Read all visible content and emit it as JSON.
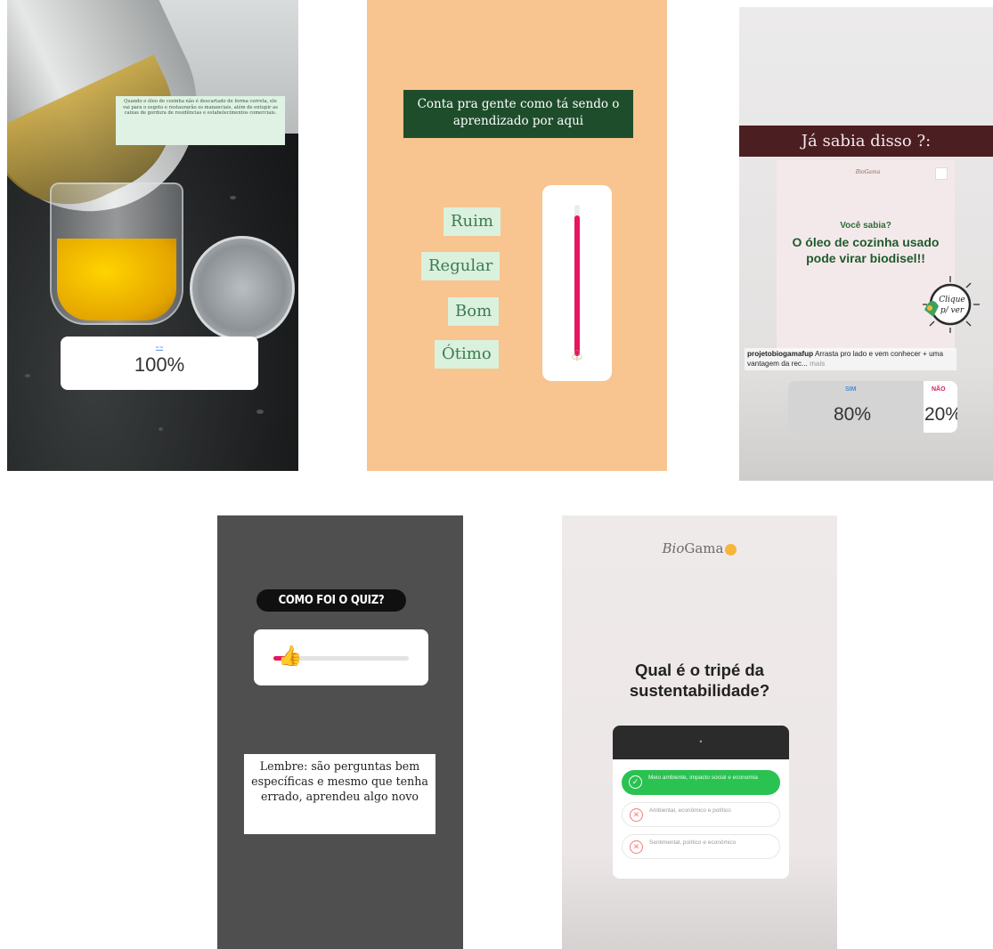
{
  "story_1": {
    "caption": "Quando o óleo de cozinha não é descartado de forma correta, ele vai para o esgoto e restaurarão os mananciais, além de entupir as caixas de gordura de residências e estabelecimentos comerciais.",
    "poll_icon": "slider-icon",
    "poll_value": "100%"
  },
  "story_2": {
    "title": "Conta pra gente como tá sendo o aprendizado por aqui",
    "options": [
      "Ruim",
      "Regular",
      "Bom",
      "Ótimo"
    ],
    "slider_level": 0.93,
    "slider_color": "#e8145f"
  },
  "story_3": {
    "header": "Já sabia disso ?:",
    "card_logo": "BioGama",
    "card_kicker": "Você sabia?",
    "card_headline": "O óleo de cozinha usado pode virar biodisel!!",
    "badge_text": "Clique p/ ver",
    "caption_user": "projetobiogamafup",
    "caption_text": " Arrasta pro lado e vem conhecer + uma vantagem da rec...",
    "caption_more": " mais",
    "poll": {
      "yes_label": "SIM",
      "yes_value": "80%",
      "no_label": "NÃO",
      "no_value": "20%",
      "yes_color": "#4a90d9",
      "no_color": "#d81b60"
    }
  },
  "story_4": {
    "question": "COMO FOI O QUIZ?",
    "slider_emoji": "👍",
    "slider_level": 0.1,
    "note": "Lembre: são perguntas bem específicas e mesmo que tenha errado, aprendeu algo novo"
  },
  "story_5": {
    "logo_bio": "Bio",
    "logo_gama": "Gama",
    "question": "Qual é o tripé da sustentabilidade?",
    "header_dot": "•",
    "options": [
      {
        "text": "Meio ambiente, impacto social e economia",
        "correct": true,
        "icon": "✓"
      },
      {
        "text": "Ambiental, econômico e político",
        "correct": false,
        "icon": "✕"
      },
      {
        "text": "Sentimental, político e econômico",
        "correct": false,
        "icon": "✕"
      }
    ],
    "correct_color": "#2ac251",
    "wrong_color": "#f17b7b"
  }
}
